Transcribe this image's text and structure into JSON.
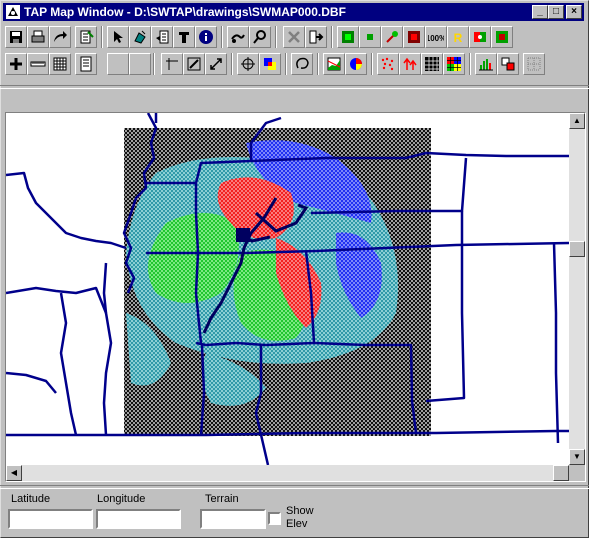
{
  "window": {
    "title": "TAP Map Window - D:\\SWTAP\\drawings\\SWMAP000.DBF",
    "minimize_glyph": "_",
    "maximize_glyph": "□",
    "close_glyph": "×"
  },
  "toolbar_row1": [
    {
      "name": "save-icon"
    },
    {
      "name": "print-icon"
    },
    {
      "name": "redo-arrow-icon"
    },
    {
      "name": "edit-checklist-icon"
    },
    {
      "name": "select-arrow-icon"
    },
    {
      "name": "paint-pointer-icon"
    },
    {
      "name": "hand-list-icon"
    },
    {
      "name": "text-tool-icon"
    },
    {
      "name": "info-icon"
    },
    {
      "name": "probe-icon"
    },
    {
      "name": "search-magnifier-icon"
    },
    {
      "name": "delete-x-icon"
    },
    {
      "name": "export-icon"
    },
    {
      "name": "green-layer-icon"
    },
    {
      "name": "green-dot-icon"
    },
    {
      "name": "pin-icon"
    },
    {
      "name": "red-layer-icon"
    },
    {
      "name": "zoom-100-icon",
      "text": "100%"
    },
    {
      "name": "yellow-r-icon",
      "text": "R"
    },
    {
      "name": "red-green-icon"
    },
    {
      "name": "green-red-icon"
    }
  ],
  "toolbar_row2": [
    {
      "name": "plus-icon"
    },
    {
      "name": "ruler-icon"
    },
    {
      "name": "grid-icon"
    },
    {
      "name": "document-icon"
    },
    {
      "name": "blank-button-1"
    },
    {
      "name": "blank-button-2"
    },
    {
      "name": "corner-tool-icon"
    },
    {
      "name": "diagonal-box-icon"
    },
    {
      "name": "resize-arrow-icon"
    },
    {
      "name": "crosshair-icon"
    },
    {
      "name": "color-squares-icon"
    },
    {
      "name": "lasso-icon"
    },
    {
      "name": "profile-chart-icon"
    },
    {
      "name": "pie-chart-icon"
    },
    {
      "name": "scatter-dots-icon"
    },
    {
      "name": "up-arrows-icon"
    },
    {
      "name": "black-grid-icon"
    },
    {
      "name": "color-grid-icon"
    },
    {
      "name": "histogram-icon"
    },
    {
      "name": "stack-icon"
    },
    {
      "name": "dotted-grid-icon"
    }
  ],
  "scroll": {
    "up_glyph": "▲",
    "down_glyph": "▼",
    "left_glyph": "◀",
    "right_glyph": "▶"
  },
  "status": {
    "latitude_label": "Latitude",
    "longitude_label": "Longitude",
    "terrain_label": "Terrain",
    "show_elev_label_1": "Show",
    "show_elev_label_2": "Elev",
    "latitude_value": "",
    "longitude_value": "",
    "terrain_value": "",
    "show_elev_checked": false
  },
  "colors": {
    "title_bar": "#000080",
    "boundary": "#00008b",
    "coverage_red": "#ff2020",
    "coverage_green": "#30e040",
    "coverage_blue": "#3040ff",
    "coverage_cyan": "#40b0c0"
  }
}
